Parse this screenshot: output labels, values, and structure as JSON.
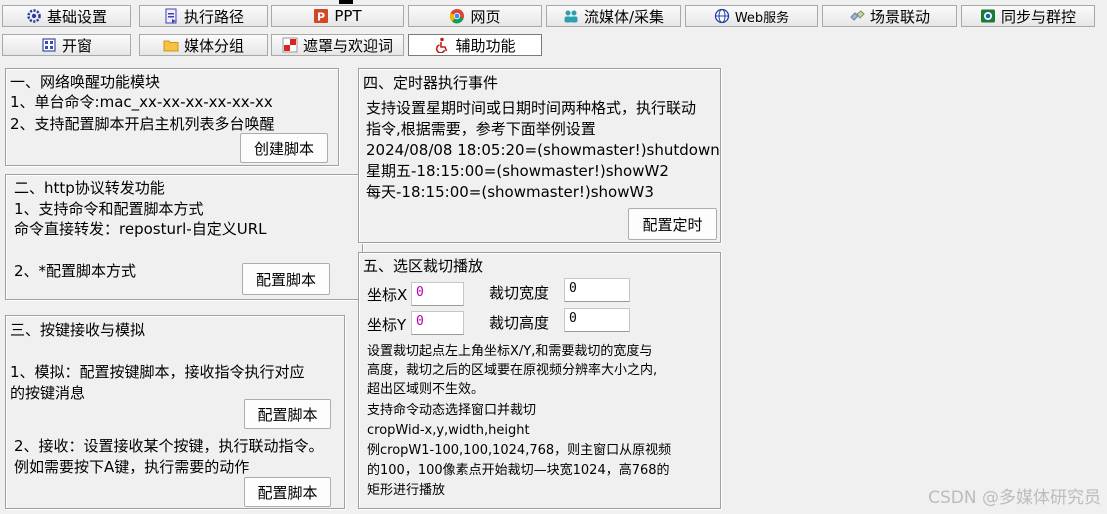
{
  "tabs_row1": [
    {
      "label": "基础设置",
      "icon": "settings-gear-icon"
    },
    {
      "label": "执行路径",
      "icon": "document-path-icon"
    },
    {
      "label": "PPT",
      "icon": "powerpoint-icon"
    },
    {
      "label": "网页",
      "icon": "chrome-browser-icon"
    },
    {
      "label": "流媒体/采集",
      "icon": "streaming-people-icon"
    },
    {
      "label": "Web服务",
      "icon": "globe-icon"
    },
    {
      "label": "场景联动",
      "icon": "scene-link-icon"
    },
    {
      "label": "同步与群控",
      "icon": "sync-screen-icon"
    }
  ],
  "tabs_row2": [
    {
      "label": "开窗",
      "icon": "window-grid-icon"
    },
    {
      "label": "媒体分组",
      "icon": "folder-icon"
    },
    {
      "label": "遮罩与欢迎词",
      "icon": "mask-icon"
    },
    {
      "label": "辅助功能",
      "icon": "accessibility-icon",
      "active": true
    }
  ],
  "wol": {
    "title": "一、网络唤醒功能模块",
    "line1": "1、单台命令:mac_xx-xx-xx-xx-xx-xx",
    "line2": "2、支持配置脚本开启主机列表多台唤醒",
    "button": "创建脚本"
  },
  "http": {
    "title": "二、http协议转发功能",
    "line1": "1、支持命令和配置脚本方式",
    "line2": "命令直接转发：reposturl-自定义URL",
    "line3": "2、*配置脚本方式",
    "button": "配置脚本"
  },
  "keys": {
    "title": "三、按键接收与模拟",
    "sim_line1": "1、模拟：配置按键脚本，接收指令执行对应",
    "sim_line2": "的按键消息",
    "sim_button": "配置脚本",
    "recv_line1": "2、接收：设置接收某个按键，执行联动指令。",
    "recv_line2": "例如需要按下A键，执行需要的动作",
    "recv_button": "配置脚本"
  },
  "timer": {
    "title": "四、定时器执行事件",
    "line1": "支持设置星期时间或日期时间两种格式，执行联动",
    "line2": "指令,根据需要，参考下面举例设置",
    "ex1": "2024/08/08 18:05:20=(showmaster!)shutdown",
    "ex2": "星期五-18:15:00=(showmaster!)showW2",
    "ex3": "每天-18:15:00=(showmaster!)showW3",
    "button": "配置定时"
  },
  "crop": {
    "title": "五、选区裁切播放",
    "x_label": "坐标X",
    "x_value": "0",
    "y_label": "坐标Y",
    "y_value": "0",
    "w_label": "裁切宽度",
    "w_value": "0",
    "h_label": "裁切高度",
    "h_value": "0",
    "desc": [
      "设置裁切起点左上角坐标X/Y,和需要裁切的宽度与",
      "高度，裁切之后的区域要在原视频分辨率大小之内,",
      "超出区域则不生效。",
      "支持命令动态选择窗口并裁切",
      "cropWid-x,y,width,height",
      "例cropW1-100,100,1024,768，则主窗口从原视频",
      "的100，100像素点开始裁切—块宽1024，高768的",
      "矩形进行播放"
    ]
  },
  "watermark": "CSDN @多媒体研究员",
  "colors": {
    "field_value_accent": "#b000b0",
    "active_tab_bg": "#ffffff"
  }
}
